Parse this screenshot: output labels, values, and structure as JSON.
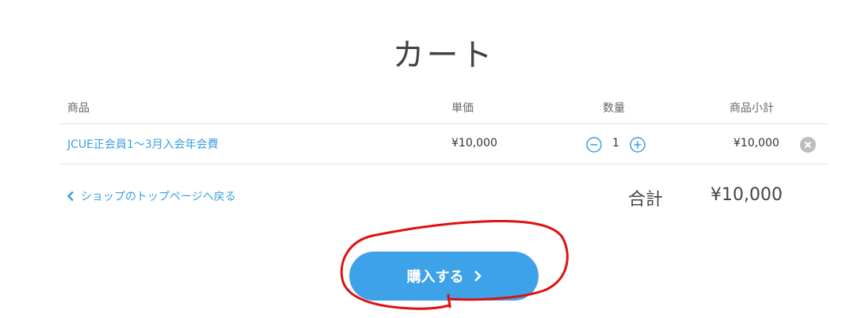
{
  "page": {
    "title": "カート"
  },
  "table": {
    "headers": {
      "product": "商品",
      "unit_price": "単価",
      "quantity": "数量",
      "subtotal": "商品小計"
    },
    "rows": [
      {
        "product": "JCUE正会員1〜3月入会年会費",
        "unit_price": "¥10,000",
        "quantity": "1",
        "subtotal": "¥10,000"
      }
    ]
  },
  "footer": {
    "back_link": "ショップのトップページへ戻る",
    "total_label": "合計",
    "total_value": "¥10,000"
  },
  "buy_button": {
    "label": "購入する"
  },
  "icons": {
    "qty_minus": "minus-circle-icon",
    "qty_plus": "plus-circle-icon",
    "remove": "close-circle-icon",
    "back": "chevron-left-icon",
    "buy": "chevron-right-icon"
  },
  "colors": {
    "accent": "#3ea2e8",
    "link": "#3b9fe3",
    "annotation": "#e01010"
  }
}
